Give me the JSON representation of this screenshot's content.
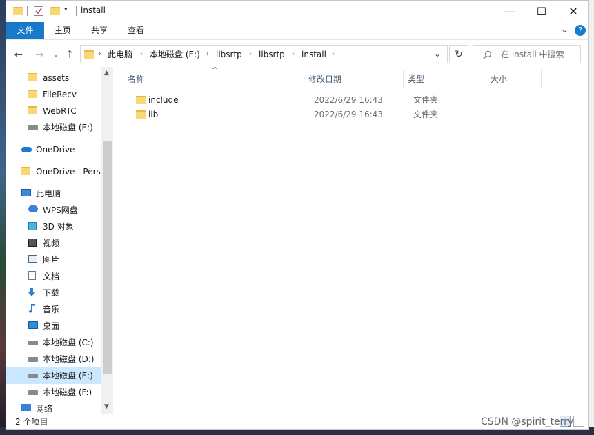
{
  "window": {
    "title": "install"
  },
  "title_controls": {
    "minimize": "—",
    "maximize": "☐",
    "close": "✕"
  },
  "ribbon": {
    "tabs": [
      "文件",
      "主页",
      "共享",
      "查看"
    ],
    "expand": "⌄",
    "help": "?"
  },
  "nav": {
    "back": "←",
    "forward": "→",
    "recent": "⌄",
    "up": "↑"
  },
  "address": {
    "crumbs": [
      "此电脑",
      "本地磁盘 (E:)",
      "libsrtp",
      "libsrtp",
      "install"
    ],
    "dropdown": "⌄",
    "refresh": "↻"
  },
  "search": {
    "placeholder": "在 install 中搜索"
  },
  "sidebar": {
    "items": [
      {
        "label": "assets",
        "icon": "folder-icon"
      },
      {
        "label": "FileRecv",
        "icon": "folder-icon"
      },
      {
        "label": "WebRTC",
        "icon": "folder-icon"
      },
      {
        "label": "本地磁盘 (E:)",
        "icon": "drive-icon"
      },
      {
        "label": "OneDrive",
        "icon": "onedrive-icon"
      },
      {
        "label": "OneDrive - Perso",
        "icon": "folder-icon"
      },
      {
        "label": "此电脑",
        "icon": "computer-icon"
      },
      {
        "label": "WPS网盘",
        "icon": "wps-cloud-icon"
      },
      {
        "label": "3D 对象",
        "icon": "3d-objects-icon"
      },
      {
        "label": "视频",
        "icon": "video-icon"
      },
      {
        "label": "图片",
        "icon": "pictures-icon"
      },
      {
        "label": "文档",
        "icon": "documents-icon"
      },
      {
        "label": "下载",
        "icon": "download-icon"
      },
      {
        "label": "音乐",
        "icon": "music-icon"
      },
      {
        "label": "桌面",
        "icon": "desktop-icon"
      },
      {
        "label": "本地磁盘 (C:)",
        "icon": "drive-icon"
      },
      {
        "label": "本地磁盘 (D:)",
        "icon": "drive-icon"
      },
      {
        "label": "本地磁盘 (E:)",
        "icon": "drive-icon"
      },
      {
        "label": "本地磁盘 (F:)",
        "icon": "drive-icon"
      },
      {
        "label": "网络",
        "icon": "network-icon"
      }
    ],
    "selected_index": 17
  },
  "columns": [
    "名称",
    "修改日期",
    "类型",
    "大小"
  ],
  "sort_indicator": "^",
  "files": [
    {
      "name": "include",
      "modified": "2022/6/29 16:43",
      "type": "文件夹",
      "size": ""
    },
    {
      "name": "lib",
      "modified": "2022/6/29 16:43",
      "type": "文件夹",
      "size": ""
    }
  ],
  "status": {
    "item_count": "2 个项目"
  },
  "watermark": "CSDN @spirit_terry"
}
